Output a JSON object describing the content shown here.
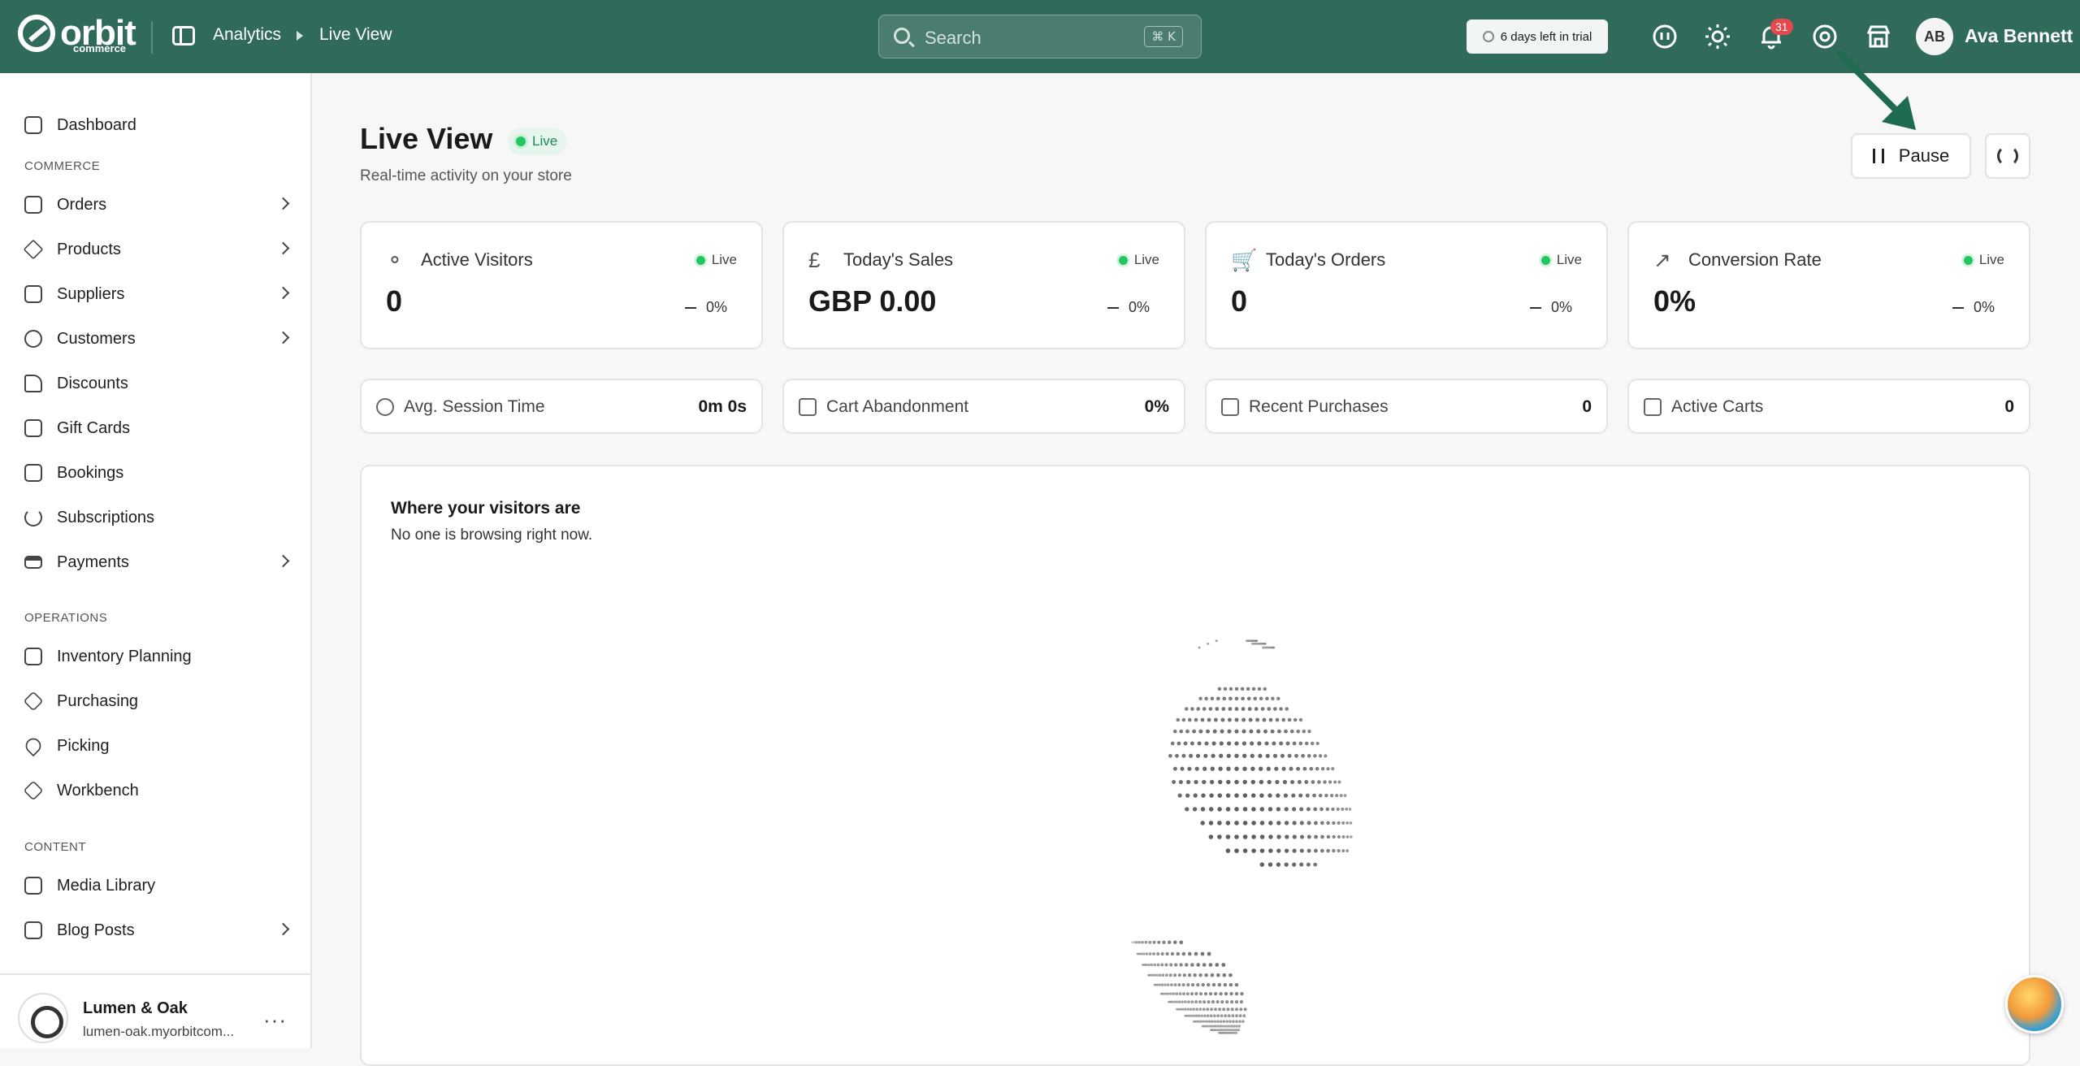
{
  "header": {
    "logo_text": "orbit",
    "logo_sub": "commerce",
    "breadcrumb": [
      "Analytics",
      "Live View"
    ],
    "search_placeholder": "Search",
    "search_shortcut": "⌘ K",
    "trial_text": "6 days left in trial",
    "notification_count": "31",
    "user_initials": "AB",
    "user_name": "Ava Bennett"
  },
  "sidebar": {
    "top": [
      {
        "label": "Dashboard",
        "icon": "dashboard-icon"
      }
    ],
    "sections": [
      {
        "title": "COMMERCE",
        "items": [
          {
            "label": "Orders",
            "icon": "orders-icon",
            "chevron": true
          },
          {
            "label": "Products",
            "icon": "products-icon",
            "chevron": true
          },
          {
            "label": "Suppliers",
            "icon": "suppliers-icon",
            "chevron": true
          },
          {
            "label": "Customers",
            "icon": "customers-icon",
            "chevron": true
          },
          {
            "label": "Discounts",
            "icon": "tag-icon",
            "chevron": false
          },
          {
            "label": "Gift Cards",
            "icon": "gift-icon",
            "chevron": false
          },
          {
            "label": "Bookings",
            "icon": "calendar-icon",
            "chevron": false
          },
          {
            "label": "Subscriptions",
            "icon": "repeat-icon",
            "chevron": false
          },
          {
            "label": "Payments",
            "icon": "card-icon",
            "chevron": true
          }
        ]
      },
      {
        "title": "OPERATIONS",
        "items": [
          {
            "label": "Inventory Planning",
            "icon": "clipboard-icon",
            "chevron": false
          },
          {
            "label": "Purchasing",
            "icon": "box-icon",
            "chevron": false
          },
          {
            "label": "Picking",
            "icon": "pin-icon",
            "chevron": false
          },
          {
            "label": "Workbench",
            "icon": "cube-icon",
            "chevron": false
          }
        ]
      },
      {
        "title": "CONTENT",
        "items": [
          {
            "label": "Media Library",
            "icon": "image-icon",
            "chevron": false
          },
          {
            "label": "Blog Posts",
            "icon": "blog-icon",
            "chevron": true
          }
        ]
      }
    ],
    "store": {
      "name": "Lumen & Oak",
      "url": "lumen-oak.myorbitcom..."
    }
  },
  "main": {
    "title": "Live View",
    "live_badge": "Live",
    "subtitle": "Real-time activity on your store",
    "pause_label": "Pause",
    "stats": [
      {
        "title": "Active Visitors",
        "value": "0",
        "change": "0%",
        "live": "Live",
        "icon": "users-icon"
      },
      {
        "title": "Today's Sales",
        "value": "GBP 0.00",
        "change": "0%",
        "live": "Live",
        "icon": "pound-icon"
      },
      {
        "title": "Today's Orders",
        "value": "0",
        "change": "0%",
        "live": "Live",
        "icon": "cart-icon"
      },
      {
        "title": "Conversion Rate",
        "value": "0%",
        "change": "0%",
        "live": "Live",
        "icon": "trend-icon"
      }
    ],
    "minis": [
      {
        "title": "Avg. Session Time",
        "value": "0m 0s",
        "icon": "clock-icon"
      },
      {
        "title": "Cart Abandonment",
        "value": "0%",
        "icon": "cart-icon"
      },
      {
        "title": "Recent Purchases",
        "value": "0",
        "icon": "bag-icon"
      },
      {
        "title": "Active Carts",
        "value": "0",
        "icon": "cart-icon"
      }
    ],
    "map": {
      "title": "Where your visitors are",
      "subtitle": "No one is browsing right now."
    }
  },
  "colors": {
    "topbar": "#2f6a5b",
    "live_green": "#22c55e",
    "arrow": "#1f6b4f",
    "badge": "#e5484d"
  }
}
